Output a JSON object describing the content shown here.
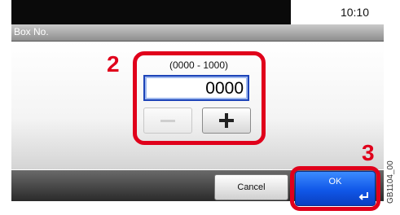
{
  "status": {
    "time": "10:10"
  },
  "screen": {
    "title": "Box No."
  },
  "box_number": {
    "range": "(0000 - 1000)",
    "value": "0000",
    "minus_label": "−",
    "plus_label": "+"
  },
  "callouts": {
    "step_input": "2",
    "step_ok": "3"
  },
  "footer": {
    "cancel_label": "Cancel",
    "ok_label": "OK"
  },
  "figure_code": "GB1104_00",
  "colors": {
    "callout": "#e0001b",
    "ok_button": "#1057e8",
    "field_border": "#1e44b8"
  }
}
